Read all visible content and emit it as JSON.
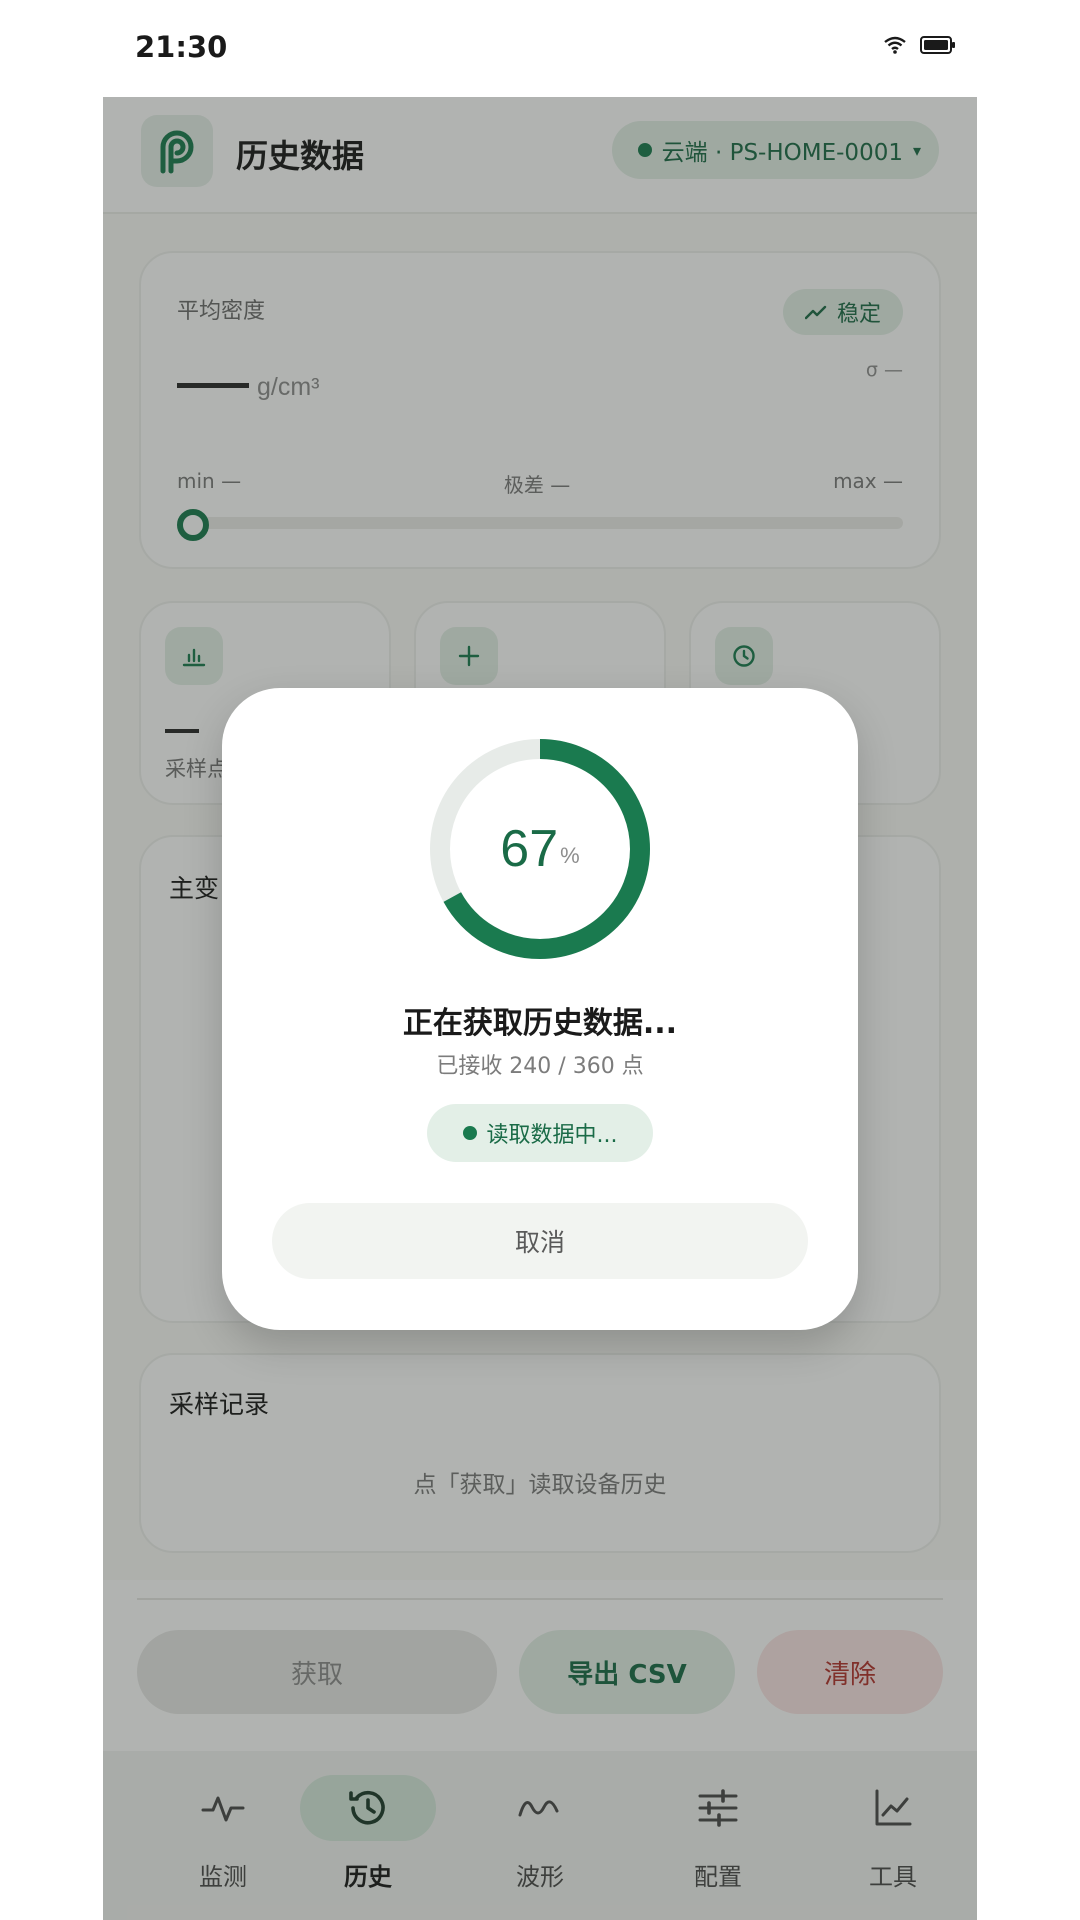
{
  "status_bar": {
    "time": "21:30"
  },
  "header": {
    "title": "历史数据",
    "device": {
      "label": "云端 · PS-HOME-0001",
      "caret": "▾"
    }
  },
  "density": {
    "label": "平均密度",
    "stability": "稳定",
    "sigma": "σ —",
    "unit": "g/cm³",
    "min": "min —",
    "range": "极差 —",
    "max": "max —"
  },
  "mini_cards": [
    {
      "icon": "bar-chart-icon",
      "label": "采样点"
    },
    {
      "icon": "plus-icon"
    },
    {
      "icon": "clock-icon"
    }
  ],
  "chart": {
    "title": "主变"
  },
  "records": {
    "title": "采样记录",
    "empty": "点「获取」读取设备历史"
  },
  "actions": {
    "fetch": "获取",
    "export": "导出 CSV",
    "clear": "清除"
  },
  "tabs": [
    {
      "label": "监测",
      "icon": "pulse-icon",
      "active": false
    },
    {
      "label": "历史",
      "icon": "history-icon",
      "active": true
    },
    {
      "label": "波形",
      "icon": "wave-icon",
      "active": false
    },
    {
      "label": "配置",
      "icon": "sliders-icon",
      "active": false
    },
    {
      "label": "工具",
      "icon": "line-chart-icon",
      "active": false
    }
  ],
  "dialog": {
    "progress": 67,
    "progress_value": "67",
    "percent_sign": "%",
    "title": "正在获取历史数据...",
    "subtitle": "已接收 240 / 360 点",
    "status": "读取数据中...",
    "cancel": "取消"
  },
  "colors": {
    "accent": "#1a7a4f",
    "accent_soft": "#e3efe7",
    "danger": "#b3322d",
    "ring_track": "#e7ebe8"
  }
}
